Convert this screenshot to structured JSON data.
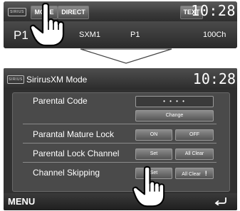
{
  "top": {
    "logo": "SIRIUS",
    "buttons": [
      "MODE",
      "DIRECT",
      "TEXT"
    ],
    "clock": "10:28",
    "preset": "P1",
    "channel_name": "SXM1",
    "preset2": "P1",
    "channel": "100Ch"
  },
  "screen": {
    "logo": "SIRIUS",
    "title": "SirirusXM Mode",
    "clock": "10:28",
    "parental_code": {
      "label": "Parental Code",
      "value": "• • • •",
      "change": "Change"
    },
    "mature_lock": {
      "label": "Parantal Mature Lock",
      "on": "ON",
      "off": "OFF"
    },
    "lock_channel": {
      "label": "Parental Lock Channel",
      "set": "Set",
      "clear": "All Clear"
    },
    "skipping": {
      "label": "Channel Skipping",
      "set": "Set",
      "clear": "All Clear"
    },
    "menu": "MENU"
  }
}
